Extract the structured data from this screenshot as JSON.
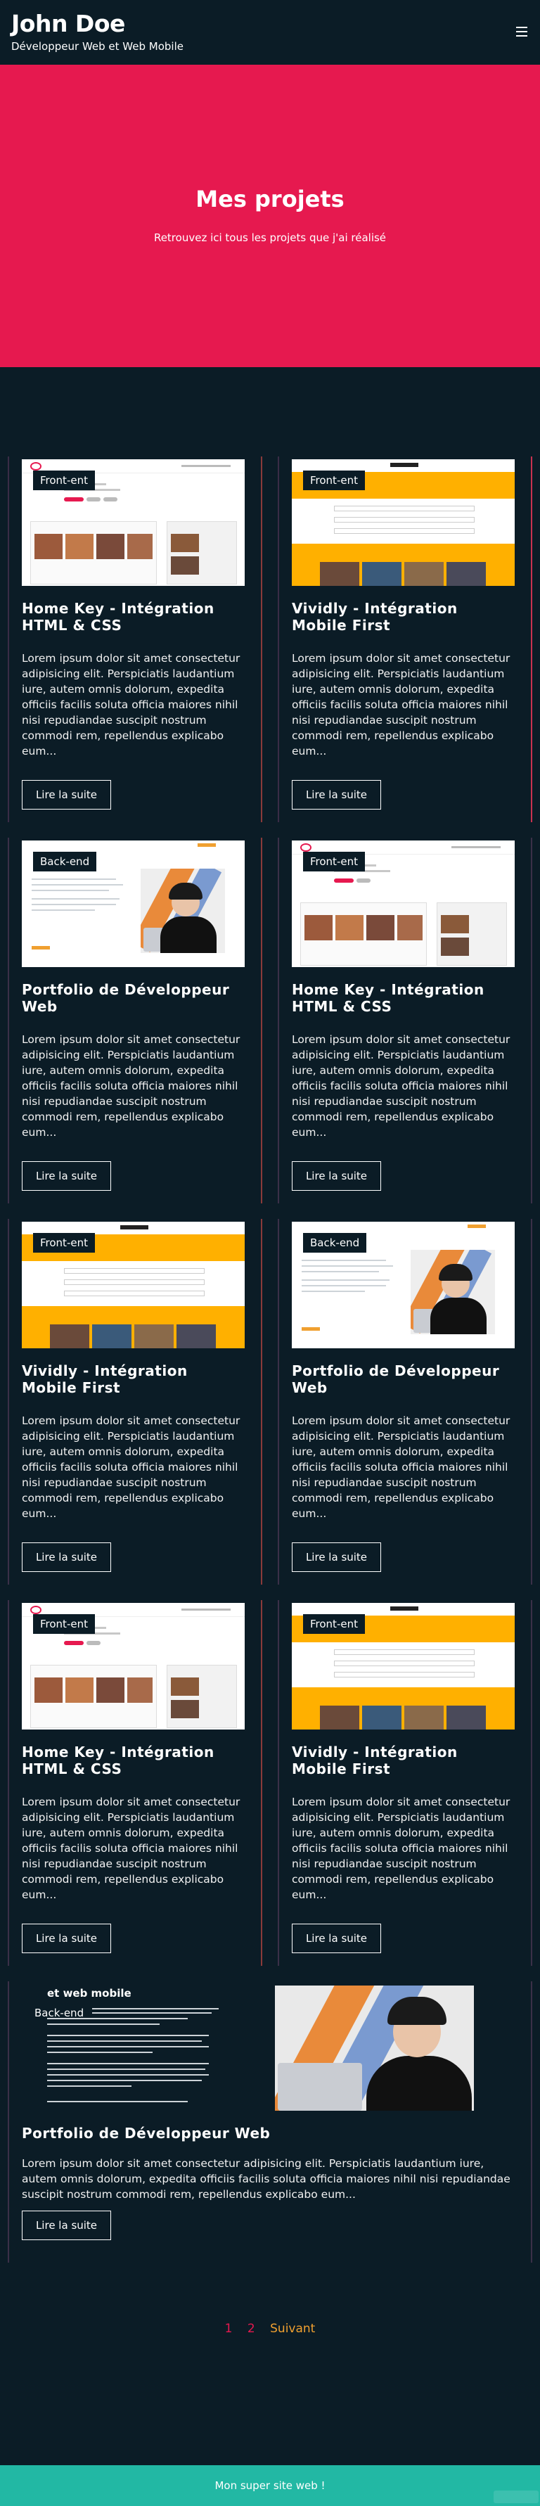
{
  "header": {
    "title": "John Doe",
    "subtitle": "Développeur Web et Web Mobile",
    "menu_icon": "hamburger-menu-icon"
  },
  "hero": {
    "title": "Mes projets",
    "subtitle": "Retrouvez ici tous les projets que j'ai réalisé"
  },
  "projects": [
    {
      "title": "Home Key - Intégration HTML & CSS",
      "badge": "Front-ent",
      "text": "Lorem ipsum dolor sit amet consectetur adipisicing elit. Perspiciatis laudantium iure, autem omnis dolorum, expedita officiis facilis soluta officia maiores nihil nisi repudiandae suscipit nostrum commodi rem, repellendus explicabo eum...",
      "button": "Lire la suite"
    },
    {
      "title": "Vividly - Intégration Mobile First",
      "badge": "Front-ent",
      "text": "Lorem ipsum dolor sit amet consectetur adipisicing elit. Perspiciatis laudantium iure, autem omnis dolorum, expedita officiis facilis soluta officia maiores nihil nisi repudiandae suscipit nostrum commodi rem, repellendus explicabo eum...",
      "button": "Lire la suite"
    },
    {
      "title": "Portfolio de Développeur Web",
      "badge": "Back-end",
      "text": "Lorem ipsum dolor sit amet consectetur adipisicing elit. Perspiciatis laudantium iure, autem omnis dolorum, expedita officiis facilis soluta officia maiores nihil nisi repudiandae suscipit nostrum commodi rem, repellendus explicabo eum...",
      "button": "Lire la suite"
    },
    {
      "title": "Home Key - Intégration HTML & CSS",
      "badge": "Front-ent",
      "text": "Lorem ipsum dolor sit amet consectetur adipisicing elit. Perspiciatis laudantium iure, autem omnis dolorum, expedita officiis facilis soluta officia maiores nihil nisi repudiandae suscipit nostrum commodi rem, repellendus explicabo eum...",
      "button": "Lire la suite"
    },
    {
      "title": "Vividly - Intégration Mobile First",
      "badge": "Front-ent",
      "text": "Lorem ipsum dolor sit amet consectetur adipisicing elit. Perspiciatis laudantium iure, autem omnis dolorum, expedita officiis facilis soluta officia maiores nihil nisi repudiandae suscipit nostrum commodi rem, repellendus explicabo eum...",
      "button": "Lire la suite"
    },
    {
      "title": "Portfolio de Développeur Web",
      "badge": "Back-end",
      "text": "Lorem ipsum dolor sit amet consectetur adipisicing elit. Perspiciatis laudantium iure, autem omnis dolorum, expedita officiis facilis soluta officia maiores nihil nisi repudiandae suscipit nostrum commodi rem, repellendus explicabo eum...",
      "button": "Lire la suite"
    },
    {
      "title": "Home Key - Intégration HTML & CSS",
      "badge": "Front-ent",
      "text": "Lorem ipsum dolor sit amet consectetur adipisicing elit. Perspiciatis laudantium iure, autem omnis dolorum, expedita officiis facilis soluta officia maiores nihil nisi repudiandae suscipit nostrum commodi rem, repellendus explicabo eum...",
      "button": "Lire la suite"
    },
    {
      "title": "Vividly - Intégration Mobile First",
      "badge": "Front-ent",
      "text": "Lorem ipsum dolor sit amet consectetur adipisicing elit. Perspiciatis laudantium iure, autem omnis dolorum, expedita officiis facilis soluta officia maiores nihil nisi repudiandae suscipit nostrum commodi rem, repellendus explicabo eum...",
      "button": "Lire la suite"
    }
  ],
  "featured": {
    "title": "Portfolio de Développeur Web",
    "badge": "Back-end",
    "thumb_heading": "et web mobile",
    "text": "Lorem ipsum dolor sit amet consectetur adipisicing elit. Perspiciatis laudantium iure, autem omnis dolorum, expedita officiis facilis soluta officia maiores nihil nisi repudiandae suscipit nostrum commodi rem, repellendus explicabo eum...",
    "button": "Lire la suite"
  },
  "pagination": {
    "pages": [
      "1",
      "2"
    ],
    "next": "Suivant"
  },
  "footer": {
    "text": "Mon super site web !"
  },
  "colors": {
    "background": "#0b1c26",
    "accent": "#e6194f",
    "footer": "#22b8a4",
    "orange": "#f0a030"
  }
}
